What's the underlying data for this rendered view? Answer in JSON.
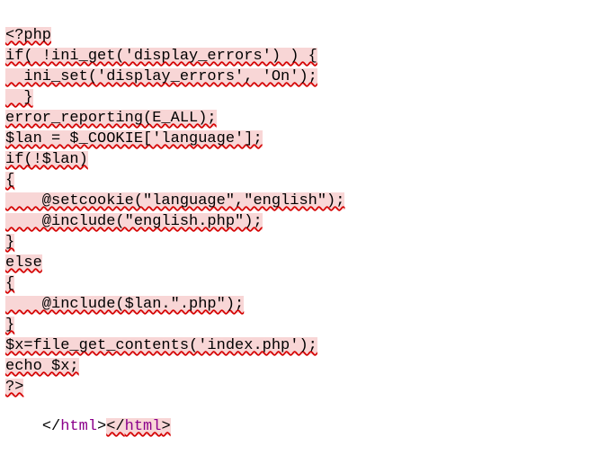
{
  "colors": {
    "highlight": "#f8d6d6",
    "squiggle": "#d40000",
    "tag": "#8b008b",
    "attr": "#0000ff"
  },
  "editor": {
    "top_fragment_prefix": "",
    "top_fragment_rest": "",
    "lines": [
      "<?php",
      "if( !ini_get('display_errors') ) {",
      "  ini_set('display_errors', 'On');",
      "  }",
      "error_reporting(E_ALL);",
      "$lan = $_COOKIE['language'];",
      "if(!$lan)",
      "{",
      "    @setcookie(\"language\",\"english\");",
      "    @include(\"english.php\");",
      "}",
      "else",
      "{",
      "    @include($lan.\".php\");",
      "}",
      "$x=file_get_contents('index.php');",
      "echo $x;",
      "?>"
    ],
    "closing": {
      "open_bracket": "</",
      "tag_name": "html",
      "close_bracket": ">",
      "hl_open_bracket": "</",
      "hl_tag_name": "html",
      "hl_close_bracket": ">"
    }
  }
}
